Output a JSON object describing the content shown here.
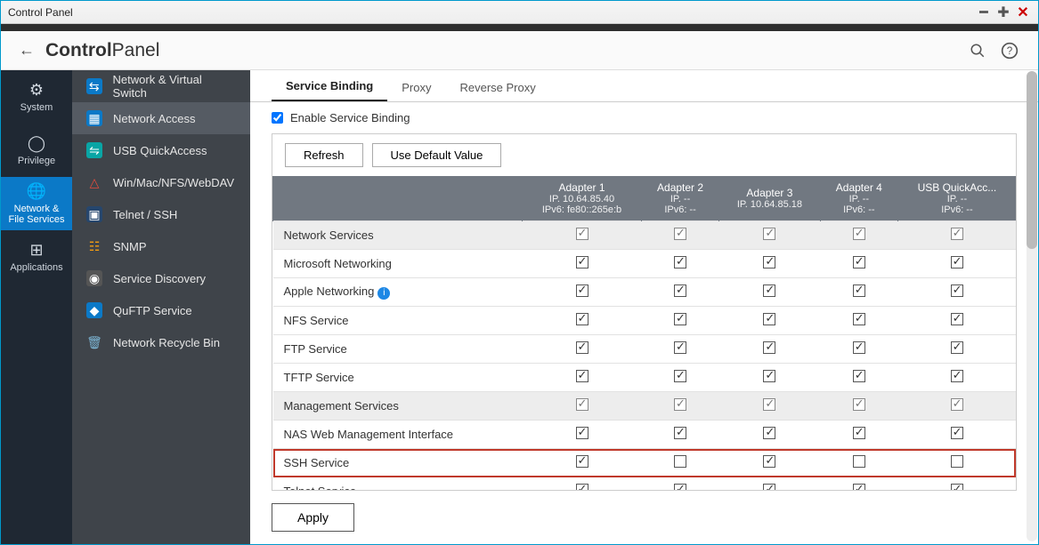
{
  "window": {
    "title": "Control Panel"
  },
  "header": {
    "title_bold": "Control",
    "title_light": "Panel"
  },
  "leftnav": [
    {
      "label": "System",
      "icon": "⚙"
    },
    {
      "label": "Privilege",
      "icon": "⛯"
    },
    {
      "label": "Network & File Services",
      "icon": "🌐"
    },
    {
      "label": "Applications",
      "icon": "⊞"
    }
  ],
  "subnav": [
    {
      "label": "Network & Virtual Switch"
    },
    {
      "label": "Network Access"
    },
    {
      "label": "USB QuickAccess"
    },
    {
      "label": "Win/Mac/NFS/WebDAV"
    },
    {
      "label": "Telnet / SSH"
    },
    {
      "label": "SNMP"
    },
    {
      "label": "Service Discovery"
    },
    {
      "label": "QuFTP Service"
    },
    {
      "label": "Network Recycle Bin"
    }
  ],
  "tabs": [
    {
      "label": "Service Binding"
    },
    {
      "label": "Proxy"
    },
    {
      "label": "Reverse Proxy"
    }
  ],
  "enable_label": "Enable Service Binding",
  "toolbar": {
    "refresh": "Refresh",
    "default": "Use Default Value"
  },
  "columns": [
    {
      "name": "Adapter 1",
      "ip": "IP. 10.64.85.40",
      "ipv6": "IPv6: fe80::265e:b"
    },
    {
      "name": "Adapter 2",
      "ip": "IP. --",
      "ipv6": "IPv6: --"
    },
    {
      "name": "Adapter 3",
      "ip": "IP. 10.64.85.18",
      "ipv6": ""
    },
    {
      "name": "Adapter 4",
      "ip": "IP. --",
      "ipv6": "IPv6: --"
    },
    {
      "name": "USB QuickAcc...",
      "ip": "IP. --",
      "ipv6": "IPv6: --"
    }
  ],
  "rows": [
    {
      "label": "Network Services",
      "section": true,
      "checks": [
        true,
        true,
        true,
        true,
        true
      ],
      "dim": true
    },
    {
      "label": "Microsoft Networking",
      "checks": [
        true,
        true,
        true,
        true,
        true
      ]
    },
    {
      "label": "Apple Networking",
      "info": true,
      "checks": [
        true,
        true,
        true,
        true,
        true
      ]
    },
    {
      "label": "NFS Service",
      "checks": [
        true,
        true,
        true,
        true,
        true
      ]
    },
    {
      "label": "FTP Service",
      "checks": [
        true,
        true,
        true,
        true,
        true
      ]
    },
    {
      "label": "TFTP Service",
      "checks": [
        true,
        true,
        true,
        true,
        true
      ]
    },
    {
      "label": "Management Services",
      "section": true,
      "checks": [
        true,
        true,
        true,
        true,
        true
      ],
      "dim": true
    },
    {
      "label": "NAS Web Management Interface",
      "checks": [
        true,
        true,
        true,
        true,
        true
      ]
    },
    {
      "label": "SSH Service",
      "highlight": true,
      "checks": [
        true,
        false,
        true,
        false,
        false
      ]
    },
    {
      "label": "Telnet Service",
      "checks": [
        true,
        true,
        true,
        true,
        true
      ]
    }
  ],
  "apply": "Apply"
}
